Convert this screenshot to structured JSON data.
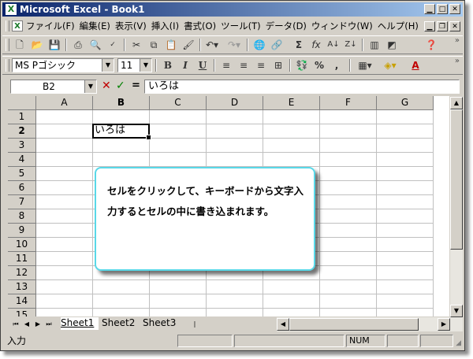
{
  "window": {
    "title": "Microsoft Excel - Book1",
    "app_icon": "excel-icon"
  },
  "caption_buttons": [
    "minimize-icon",
    "maximize-icon",
    "close-icon"
  ],
  "menubar": {
    "items": [
      "ファイル(F)",
      "編集(E)",
      "表示(V)",
      "挿入(I)",
      "書式(O)",
      "ツール(T)",
      "データ(D)",
      "ウィンドウ(W)",
      "ヘルプ(H)"
    ]
  },
  "standard_toolbar": {
    "buttons": [
      "new-icon",
      "open-icon",
      "save-icon",
      "print-icon",
      "print-preview-icon",
      "spelling-icon",
      "cut-icon",
      "copy-icon",
      "paste-icon",
      "format-painter-icon",
      "undo-icon",
      "redo-icon",
      "hyperlink-icon",
      "web-icon",
      "autosum-icon",
      "function-icon",
      "sort-ascending-icon",
      "sort-descending-icon",
      "chart-wizard-icon",
      "help-icon"
    ]
  },
  "format_toolbar": {
    "font_name": "MS Pゴシック",
    "font_size": "11",
    "buttons": [
      "bold-icon",
      "italic-icon",
      "underline-icon",
      "align-left-icon",
      "align-center-icon",
      "align-right-icon",
      "merge-center-icon",
      "currency-icon",
      "percent-icon",
      "comma-icon",
      "borders-icon",
      "fill-color-icon",
      "font-color-icon"
    ],
    "bold_label": "B",
    "italic_label": "I",
    "underline_label": "U",
    "percent_label": "%",
    "comma_label": ",",
    "font_color_label": "A"
  },
  "formula_bar": {
    "name_box": "B2",
    "equals": "=",
    "formula": "いろは"
  },
  "sheet": {
    "columns": [
      "A",
      "B",
      "C",
      "D",
      "E",
      "F",
      "G"
    ],
    "rows": [
      "1",
      "2",
      "3",
      "4",
      "5",
      "6",
      "7",
      "8",
      "9",
      "10",
      "11",
      "12",
      "13",
      "14",
      "15"
    ],
    "active_cell": {
      "ref": "B2",
      "value": "いろは"
    }
  },
  "sheet_tabs": [
    "Sheet1",
    "Sheet2",
    "Sheet3"
  ],
  "status_bar": {
    "mode": "入力",
    "num": "NUM"
  },
  "callout": {
    "text": "セルをクリックして、キーボードから文字入力するとセルの中に書き込まれます。"
  },
  "colors": {
    "titlebar_start": "#0a246a",
    "titlebar_end": "#a6caf0",
    "callout_border": "#59d8e8",
    "cancel_red": "#c00000",
    "enter_green": "#008000"
  }
}
